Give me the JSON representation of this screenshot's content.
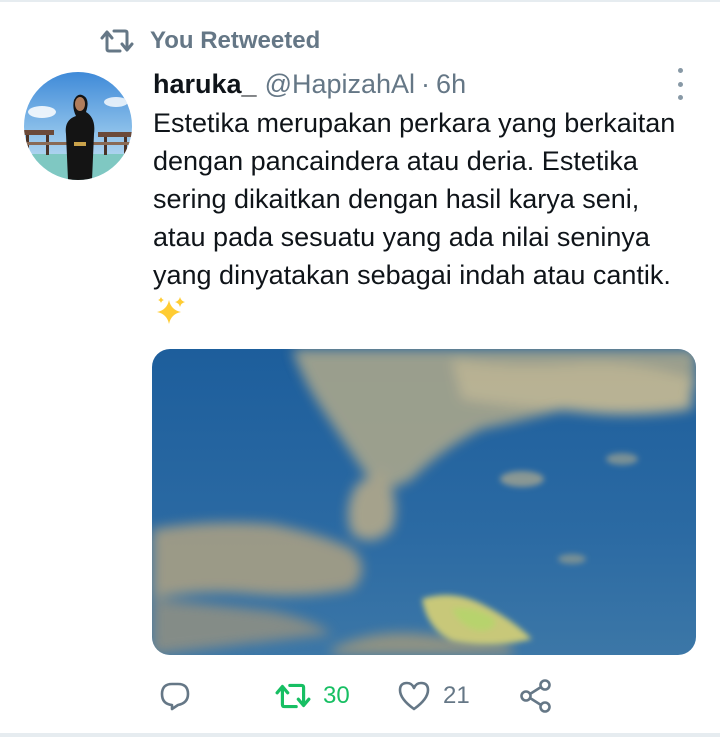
{
  "retweet_context": {
    "icon": "retweet-icon",
    "label": "You Retweeted"
  },
  "tweet": {
    "author_name": "haruka_",
    "author_handle": "@HapizahAl",
    "separator": "·",
    "time": "6h",
    "text": "Estetika merupakan perkara yang berkaitan dengan pancaindera atau deria. Estetika sering dikaitkan dengan hasil karya seni, atau pada sesuatu yang ada nilai seninya yang dinyatakan sebagai indah atau cantik.",
    "emoji": "sparkles-emoji"
  },
  "actions": {
    "reply": {
      "icon": "reply-icon",
      "count": ""
    },
    "retweet": {
      "icon": "retweet-icon",
      "count": "30",
      "active": true,
      "color": "#17bf63"
    },
    "like": {
      "icon": "heart-icon",
      "count": "21"
    },
    "share": {
      "icon": "share-icon"
    }
  },
  "colors": {
    "secondary_text": "#657786",
    "primary_text": "#0f1419",
    "retweet_green": "#17bf63"
  }
}
